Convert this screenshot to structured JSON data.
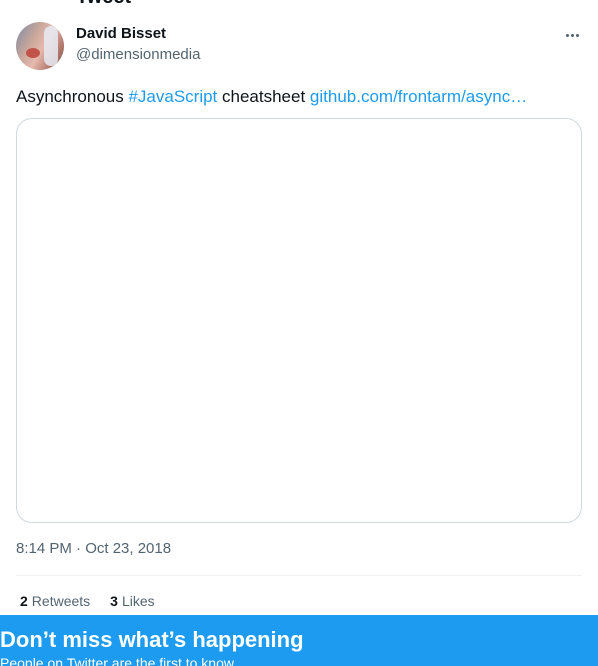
{
  "header": {
    "title": "Tweet"
  },
  "author": {
    "name": "David Bisset",
    "handle": "@dimensionmedia"
  },
  "tweet": {
    "text_before": "Asynchronous ",
    "hashtag": "#JavaScript",
    "text_mid": " cheatsheet ",
    "link": "github.com/frontarm/async…",
    "timestamp": "8:14 PM · Oct 23, 2018"
  },
  "stats": {
    "retweets_count": "2",
    "retweets_label": "Retweets",
    "likes_count": "3",
    "likes_label": "Likes"
  },
  "banner": {
    "title": "Don’t miss what’s happening",
    "subtitle": "People on Twitter are the first to know."
  },
  "icons": {
    "more": "more-horizontal-icon",
    "avatar": "user-avatar-photo"
  },
  "colors": {
    "accent": "#1d9bf0",
    "text": "#0f1419",
    "muted": "#536471",
    "border": "#cfd9de"
  }
}
